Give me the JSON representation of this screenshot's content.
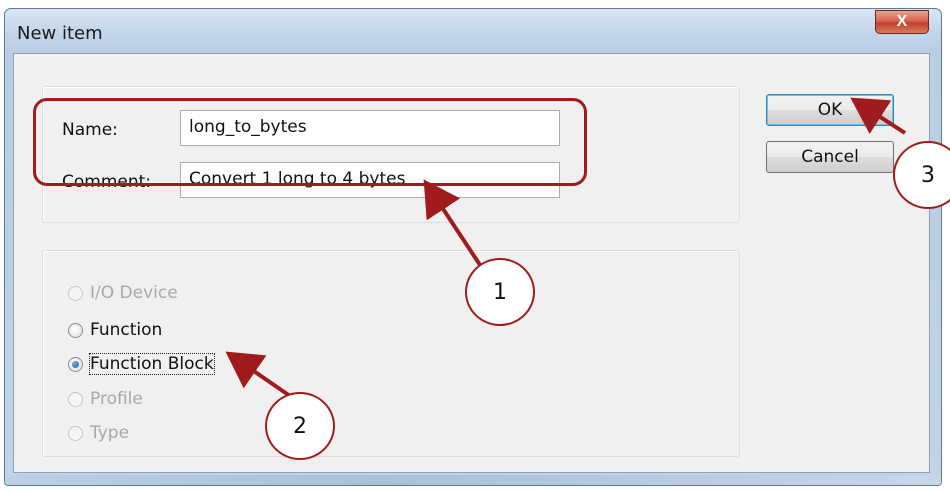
{
  "window": {
    "title": "New item",
    "close_glyph": "X"
  },
  "form": {
    "name_label": "Name:",
    "name_value": "long_to_bytes",
    "comment_label": "Comment:",
    "comment_value": "Convert 1 long to 4 bytes"
  },
  "buttons": {
    "ok_label": "OK",
    "cancel_label": "Cancel"
  },
  "item_types": [
    {
      "label": "I/O Device",
      "enabled": false,
      "checked": false
    },
    {
      "label": "Function",
      "enabled": true,
      "checked": false
    },
    {
      "label": "Function Block",
      "enabled": true,
      "checked": true
    },
    {
      "label": "Profile",
      "enabled": false,
      "checked": false
    },
    {
      "label": "Type",
      "enabled": false,
      "checked": false
    }
  ],
  "annotations": {
    "callout_1": "1",
    "callout_2": "2",
    "callout_3": "3",
    "color": "#a01c1c"
  }
}
